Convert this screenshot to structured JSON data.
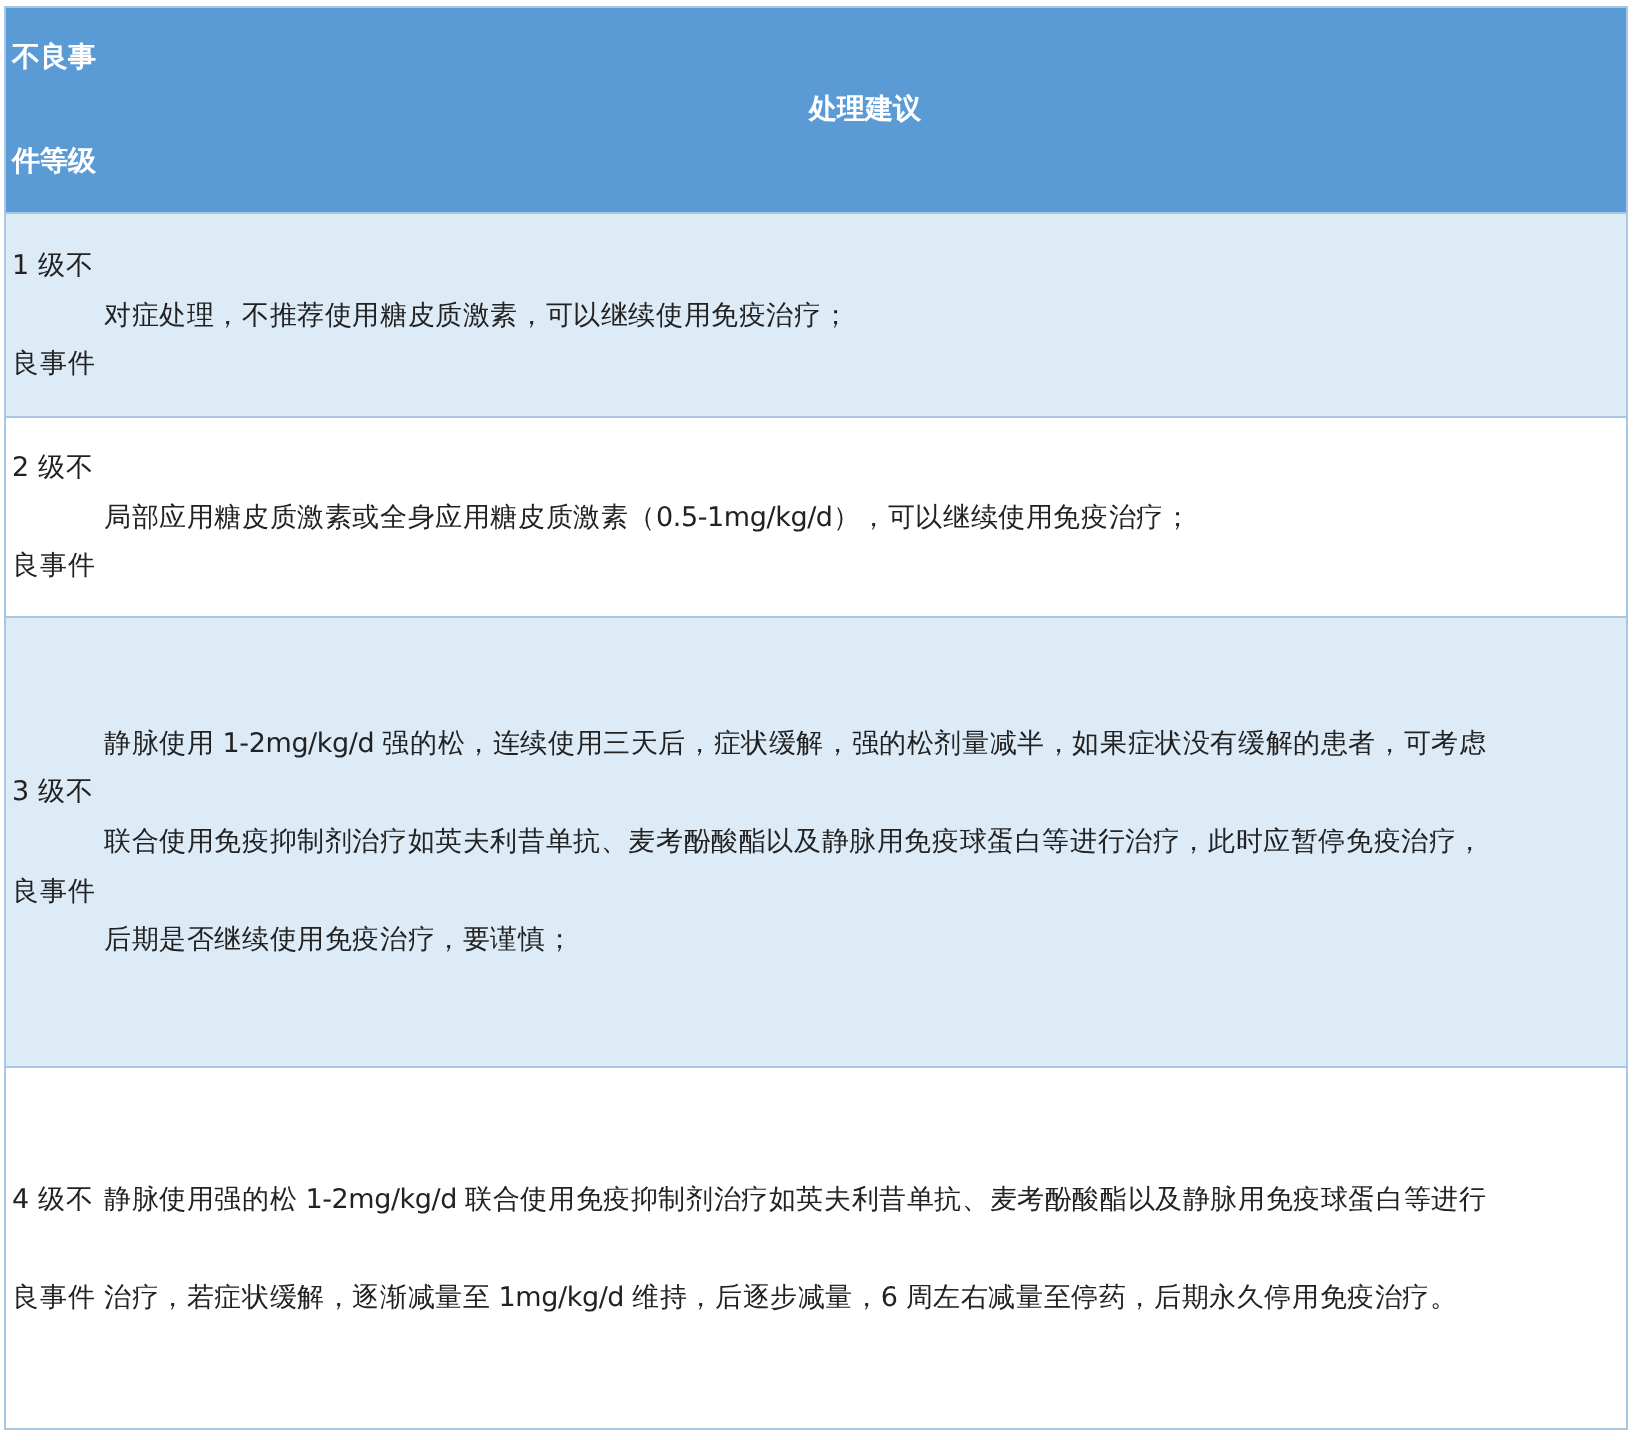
{
  "table": {
    "header": {
      "grade_lines": [
        "不良事",
        "件等级"
      ],
      "advice": "处理建议"
    },
    "rows": [
      {
        "kind": "compact",
        "shaded": true,
        "lines": [
          {
            "grade": "1 级不"
          },
          {
            "advice": "对症处理，不推荐使用糖皮质激素，可以继续使用免疫治疗；"
          },
          {
            "grade": "良事件"
          }
        ]
      },
      {
        "kind": "compact",
        "shaded": false,
        "lines": [
          {
            "grade": "2 级不"
          },
          {
            "advice": "局部应用糖皮质激素或全身应用糖皮质激素（0.5-1mg/kg/d），可以继续使用免疫治疗；"
          },
          {
            "grade": "良事件"
          }
        ]
      },
      {
        "kind": "compact",
        "shaded": true,
        "lines": [
          {
            "advice": "静脉使用 1-2mg/kg/d 强的松，连续使用三天后，症状缓解，强的松剂量减半，如果症状没有缓解的患者，可考虑"
          },
          {
            "grade": "3 级不"
          },
          {
            "advice": "联合使用免疫抑制剂治疗如英夫利昔单抗、麦考酚酸酯以及静脉用免疫球蛋白等进行治疗，此时应暂停免疫治疗，"
          },
          {
            "grade": "良事件"
          },
          {
            "advice": "后期是否继续使用免疫治疗，要谨慎；"
          }
        ]
      },
      {
        "kind": "spaced",
        "shaded": false,
        "lines": [
          {
            "grade": "4 级不",
            "advice": "静脉使用强的松 1-2mg/kg/d 联合使用免疫抑制剂治疗如英夫利昔单抗、麦考酚酸酯以及静脉用免疫球蛋白等进行"
          },
          {
            "grade": "良事件",
            "advice": "治疗，若症状缓解，逐渐减量至 1mg/kg/d 维持，后逐步减量，6 周左右减量至停药，后期永久停用免疫治疗。"
          }
        ]
      }
    ]
  }
}
